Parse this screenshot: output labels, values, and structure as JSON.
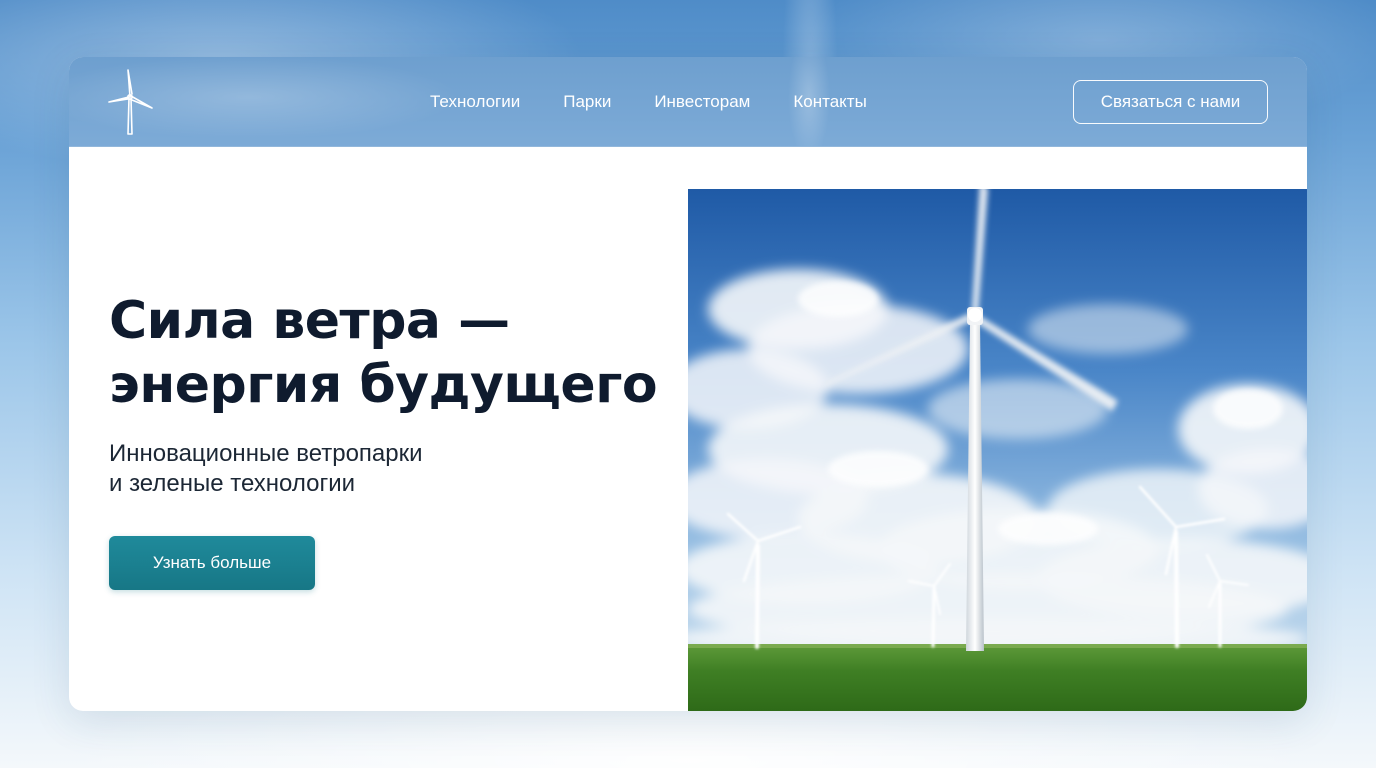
{
  "header": {
    "logo_icon": "wind-turbine-icon",
    "nav": [
      {
        "label": "Технологии"
      },
      {
        "label": "Парки"
      },
      {
        "label": "Инвесторам"
      },
      {
        "label": "Контакты"
      }
    ],
    "contact_label": "Связаться с нами"
  },
  "hero": {
    "title_line1": "Сила ветра —",
    "title_line2": "энергия будущего",
    "subtitle_line1": "Инновационные ветропарки",
    "subtitle_line2": "и зеленые технологии",
    "cta_label": "Узнать больше",
    "image_icon": "wind-farm-photo"
  },
  "colors": {
    "accent": "#1a8090",
    "title": "#0f1b2e",
    "header_bg": "#5a93cc"
  }
}
